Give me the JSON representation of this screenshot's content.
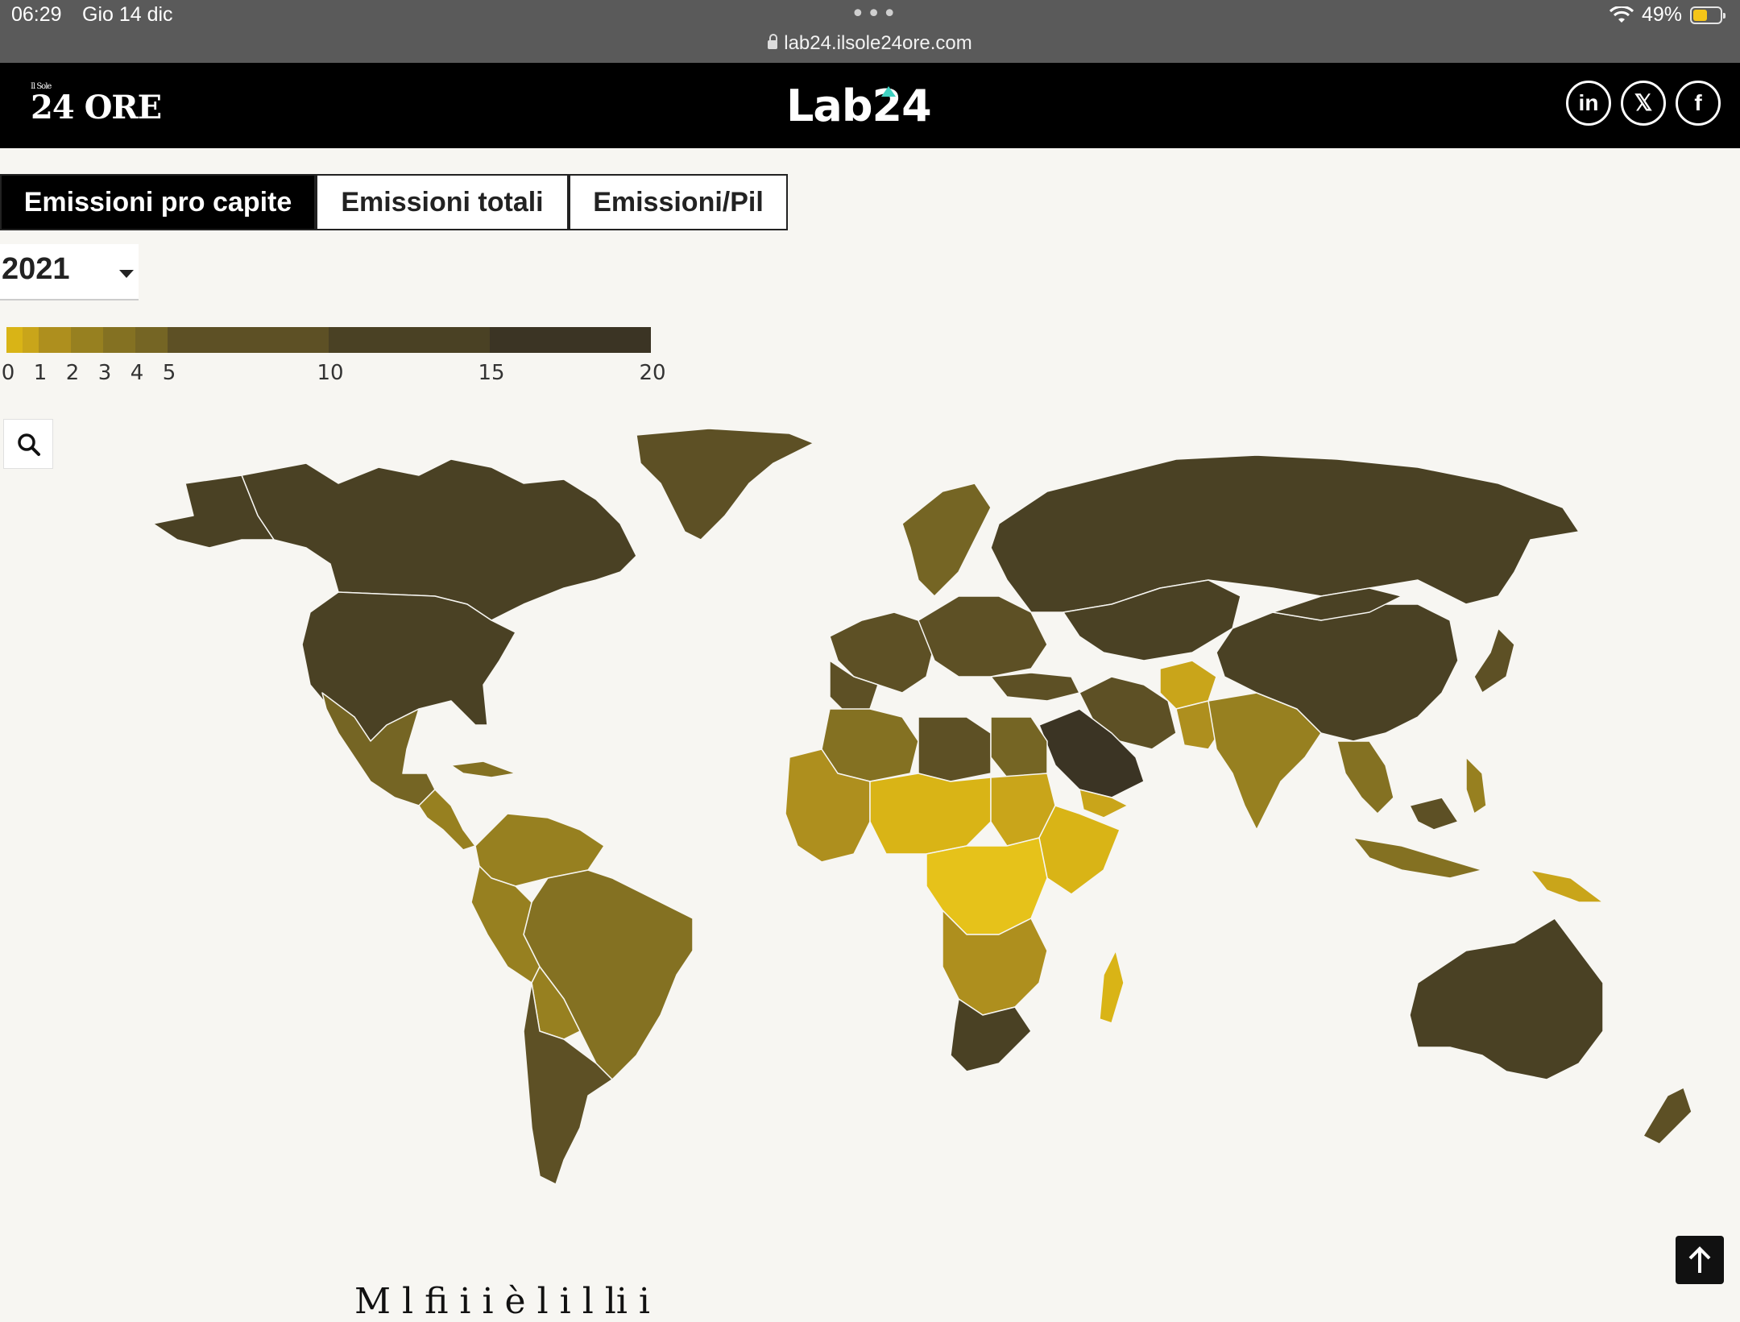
{
  "status": {
    "time": "06:29",
    "date": "Gio 14 dic",
    "url": "lab24.ilsole24ore.com",
    "battery": "49%"
  },
  "header": {
    "brand_small": "Il Sole",
    "brand": "24 ORE",
    "lab_logo": "Lab24",
    "social": [
      "in",
      "𝕏",
      "f"
    ]
  },
  "tabs": [
    "Emissioni pro capite",
    "Emissioni totali",
    "Emissioni/Pil"
  ],
  "active_tab": 0,
  "year": "2021",
  "legend": {
    "ticks": [
      "0",
      "1",
      "2",
      "3",
      "4",
      "5",
      "10",
      "15",
      "20"
    ],
    "stops": [
      {
        "from": 0,
        "to": 0.5,
        "color": "#d9b416"
      },
      {
        "from": 0.5,
        "to": 1,
        "color": "#c9a51a"
      },
      {
        "from": 1,
        "to": 2,
        "color": "#ae8f1e"
      },
      {
        "from": 2,
        "to": 3,
        "color": "#978020"
      },
      {
        "from": 3,
        "to": 4,
        "color": "#847122"
      },
      {
        "from": 4,
        "to": 5,
        "color": "#756524"
      },
      {
        "from": 5,
        "to": 10,
        "color": "#5d5025"
      },
      {
        "from": 10,
        "to": 15,
        "color": "#4a4124"
      },
      {
        "from": 15,
        "to": 20,
        "color": "#3b3424"
      }
    ]
  },
  "icons": {
    "search": "search-icon",
    "back_to_top": "arrow-up-icon"
  },
  "bottom_text": "M  l    fi     i     i   è                l  i      l  li   i"
}
